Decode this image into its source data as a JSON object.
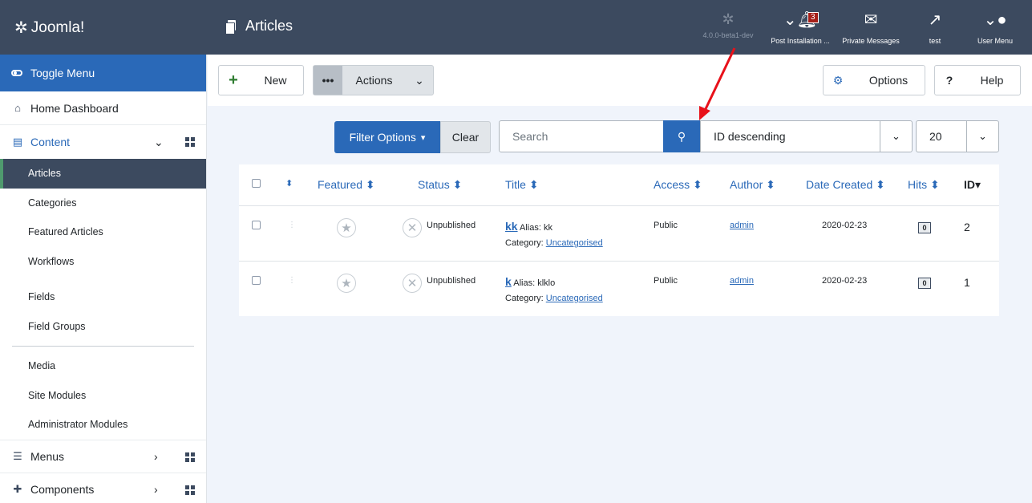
{
  "header": {
    "logo_text": "Joomla!",
    "page_title": "Articles",
    "version": "4.0.0-beta1-dev",
    "notifications": {
      "label": "Post Installation ...",
      "count": "3"
    },
    "messages_label": "Private Messages",
    "site_label": "test",
    "user_label": "User Menu"
  },
  "sidebar": {
    "toggle": "Toggle Menu",
    "home": "Home Dashboard",
    "content": "Content",
    "items": [
      "Articles",
      "Categories",
      "Featured Articles",
      "Workflows",
      "Fields",
      "Field Groups",
      "Media",
      "Site Modules",
      "Administrator Modules"
    ],
    "menus": "Menus",
    "components": "Components"
  },
  "toolbar": {
    "new_label": "New",
    "actions_label": "Actions",
    "options_label": "Options",
    "help_label": "Help"
  },
  "filters": {
    "filter_options": "Filter Options",
    "clear": "Clear",
    "search_placeholder": "Search",
    "sort": "ID descending",
    "limit": "20"
  },
  "table": {
    "columns": [
      "Featured",
      "Status",
      "Title",
      "Access",
      "Author",
      "Date Created",
      "Hits",
      "ID"
    ],
    "rows": [
      {
        "status": "Unpublished",
        "title": "kk",
        "alias": "Alias: kk",
        "category_label": "Category:",
        "category": "Uncategorised",
        "access": "Public",
        "author": "admin",
        "date": "2020-02-23",
        "hits": "0",
        "id": "2"
      },
      {
        "status": "Unpublished",
        "title": "k",
        "alias": "Alias: klklo",
        "category_label": "Category:",
        "category": "Uncategorised",
        "access": "Public",
        "author": "admin",
        "date": "2020-02-23",
        "hits": "0",
        "id": "1"
      }
    ]
  },
  "colors": {
    "header_bg": "#3c4a5f",
    "accent": "#2a69b8",
    "annotation_arrow": "#e8111a"
  }
}
